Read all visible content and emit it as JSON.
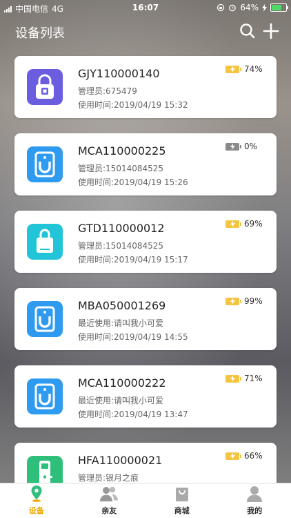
{
  "status_bar": {
    "carrier": "中国电信",
    "network": "4G",
    "time": "16:07",
    "battery": "64%"
  },
  "header": {
    "title": "设备列表",
    "search_icon": "search-icon",
    "add_icon": "plus-icon"
  },
  "devices": [
    {
      "name": "GJY110000140",
      "line1": "管理员:675479",
      "line2": "使用时间:2019/04/19 15:32",
      "battery": "74%",
      "battery_on": true,
      "icon": "padlock",
      "icon_color": "#6b5de0"
    },
    {
      "name": "MCA110000225",
      "line1": "管理员:15014084525",
      "line2": "使用时间:2019/04/19 15:26",
      "battery": "0%",
      "battery_on": false,
      "icon": "cabinet-lock",
      "icon_color": "#2f9bf0"
    },
    {
      "name": "GTD110000012",
      "line1": "管理员:15014084525",
      "line2": "使用时间:2019/04/19 15:17",
      "battery": "69%",
      "battery_on": true,
      "icon": "bag-lock",
      "icon_color": "#22c4d8"
    },
    {
      "name": "MBA050001269",
      "line1": "最近使用:请叫我小可爱",
      "line2": "使用时间:2019/04/19 14:55",
      "battery": "99%",
      "battery_on": true,
      "icon": "cabinet-lock",
      "icon_color": "#2f9bf0"
    },
    {
      "name": "MCA110000222",
      "line1": "最近使用:请叫我小可爱",
      "line2": "使用时间:2019/04/19 13:47",
      "battery": "71%",
      "battery_on": true,
      "icon": "cabinet-lock",
      "icon_color": "#2f9bf0"
    },
    {
      "name": "HFA110000021",
      "line1": "管理员:银月之痕",
      "line2": "",
      "battery": "66%",
      "battery_on": true,
      "icon": "door-lock",
      "icon_color": "#2ec07a"
    }
  ],
  "tabbar": {
    "items": [
      {
        "label": "设备",
        "icon": "location-pin-icon",
        "active": true,
        "color": "#f0a800"
      },
      {
        "label": "亲友",
        "icon": "people-icon",
        "active": false
      },
      {
        "label": "商城",
        "icon": "shopping-bag-icon",
        "active": false
      },
      {
        "label": "我的",
        "icon": "person-icon",
        "active": false
      }
    ]
  }
}
